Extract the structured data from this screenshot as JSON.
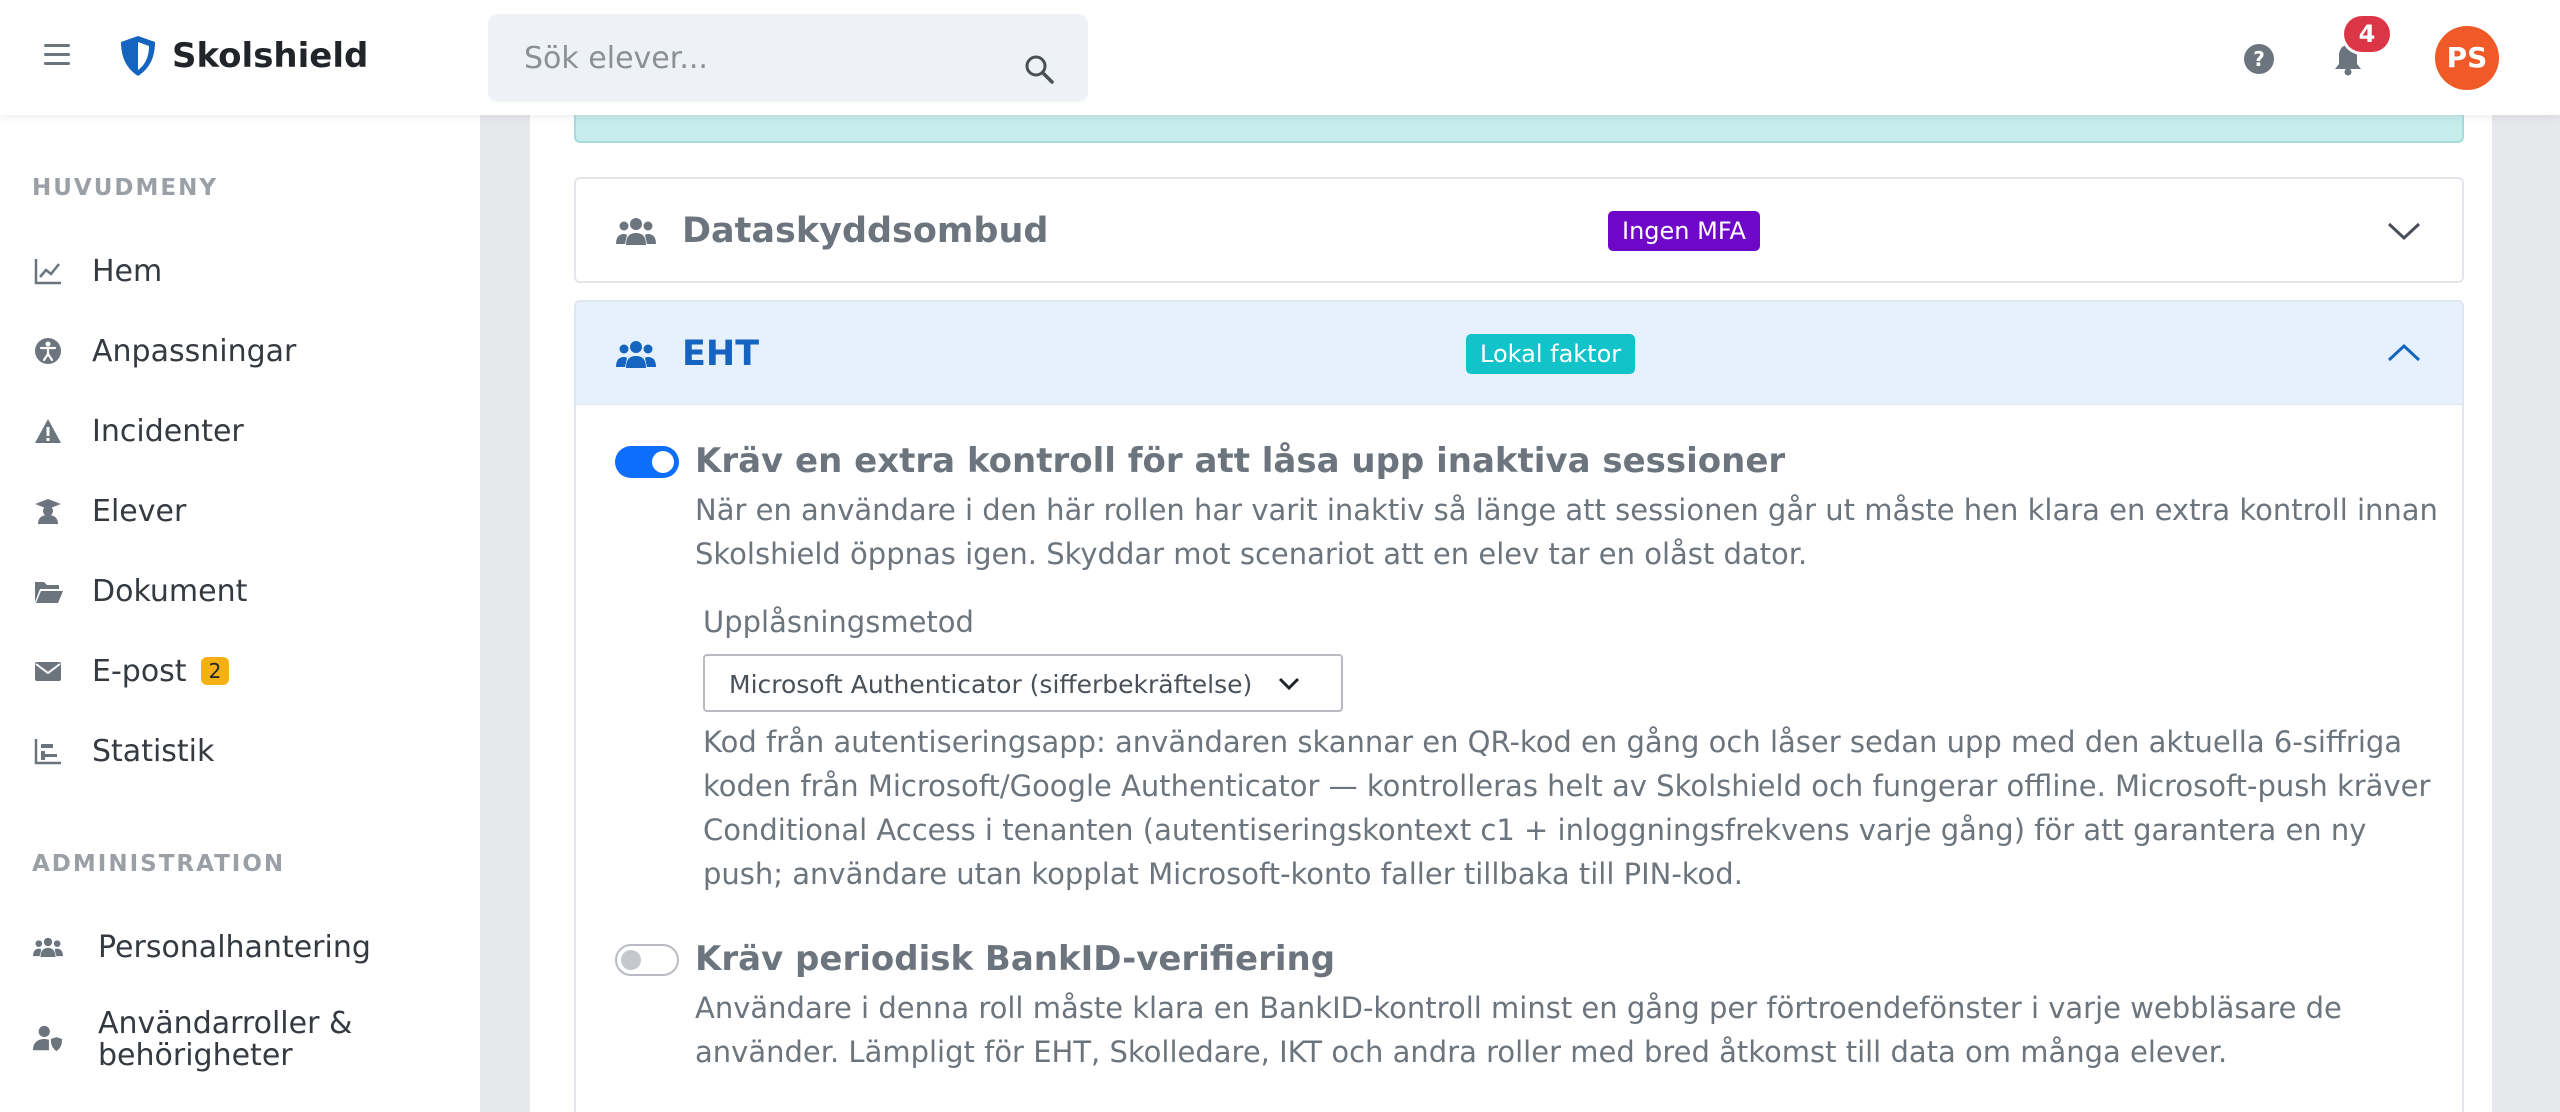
{
  "app": {
    "name": "Skolshield"
  },
  "search": {
    "placeholder": "Sök elever..."
  },
  "topbar": {
    "help_symbol": "?",
    "notifications_count": "4",
    "avatar_initials": "PS"
  },
  "sidebar": {
    "main_section": "HUVUDMENY",
    "items": [
      {
        "label": "Hem",
        "icon": "chart-line-icon"
      },
      {
        "label": "Anpassningar",
        "icon": "accessibility-icon"
      },
      {
        "label": "Incidenter",
        "icon": "warning-icon"
      },
      {
        "label": "Elever",
        "icon": "student-icon"
      },
      {
        "label": "Dokument",
        "icon": "folder-open-icon"
      },
      {
        "label": "E-post",
        "icon": "envelope-icon",
        "badge": "2"
      },
      {
        "label": "Statistik",
        "icon": "bar-chart-icon"
      }
    ],
    "admin_section": "ADMINISTRATION",
    "admin_items": [
      {
        "label": "Personalhantering",
        "icon": "users-icon"
      },
      {
        "label_line1": "Användarroller &",
        "label_line2": "behörigheter",
        "icon": "user-shield-icon"
      }
    ]
  },
  "roles": [
    {
      "title": "Dataskyddsombud",
      "badge": "Ingen MFA",
      "badge_color": "#6f07c9",
      "expanded": false
    },
    {
      "title": "EHT",
      "badge": "Lokal faktor",
      "badge_color": "#12c3c9",
      "expanded": true
    }
  ],
  "settings": {
    "unlock": {
      "enabled": true,
      "title": "Kräv en extra kontroll för att låsa upp inaktiva sessioner",
      "desc_line1": "När en användare i den här rollen har varit inaktiv så länge att sessionen går ut måste hen klara en extra kontroll innan",
      "desc_line2": "Skolshield öppnas igen. Skyddar mot scenariot att en elev tar en olåst dator.",
      "method_label": "Upplåsningsmetod",
      "method_value": "Microsoft Authenticator (sifferbekräftelse)",
      "help_line1": "Kod från autentiseringsapp: användaren skannar en QR-kod en gång och låser sedan upp med den aktuella 6-siffriga",
      "help_line2": "koden från Microsoft/Google Authenticator — kontrolleras helt av Skolshield och fungerar offline. Microsoft-push kräver",
      "help_line3": "Conditional Access i tenanten (autentiseringskontext c1 + inloggningsfrekvens varje gång) för att garantera en ny",
      "help_line4": "push; användare utan kopplat Microsoft-konto faller tillbaka till PIN-kod."
    },
    "bankid": {
      "enabled": false,
      "title": "Kräv periodisk BankID-verifiering",
      "desc_line1": "Användare i denna roll måste klara en BankID-kontroll minst en gång per förtroendefönster i varje webbläsare de",
      "desc_line2": "använder. Lämpligt för EHT, Skolledare, IKT och andra roller med bred åtkomst till data om många elever."
    }
  },
  "colors": {
    "accent": "#0d6efd",
    "accordion_open_title": "#1565c0",
    "alert_bg": "#c6ecec"
  }
}
